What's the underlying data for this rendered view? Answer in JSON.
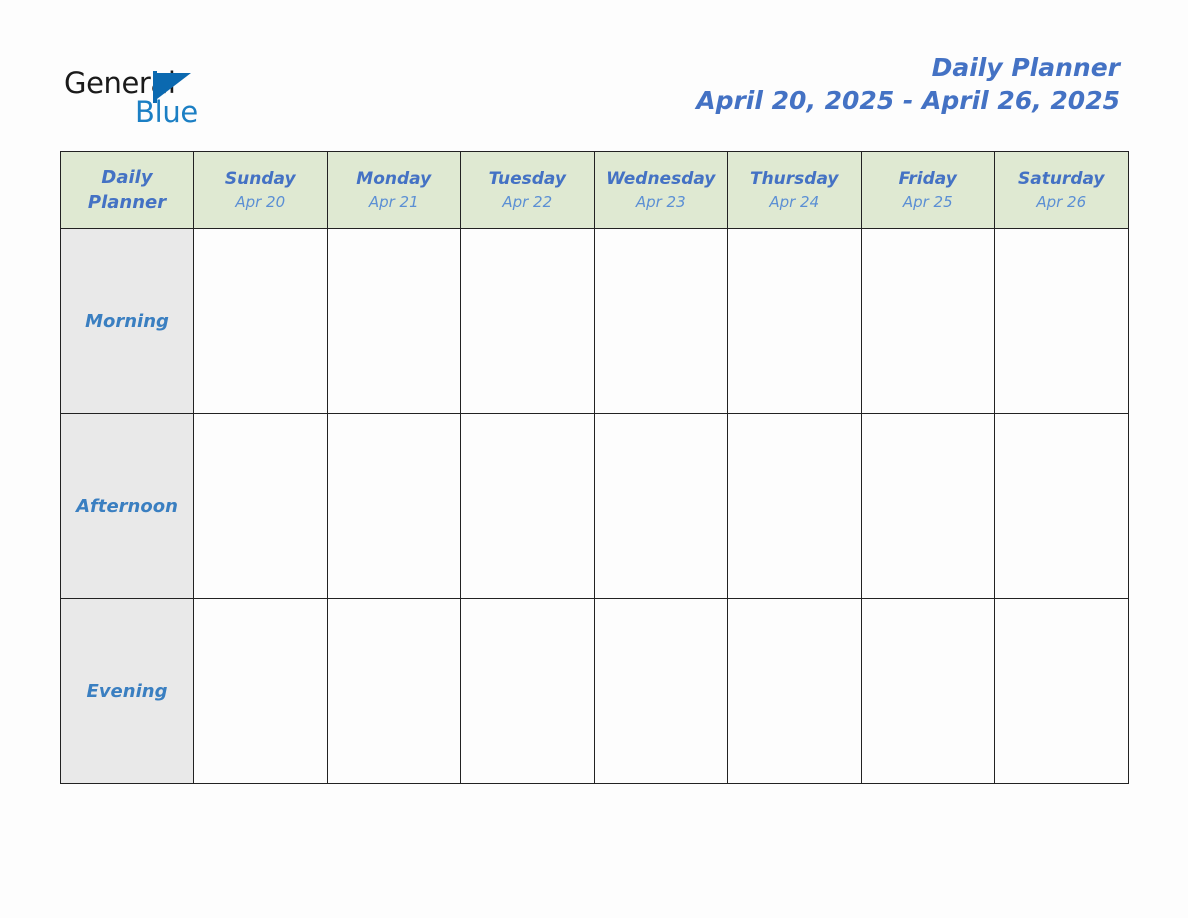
{
  "brand": {
    "name_part1": "General",
    "name_part2": "Blue",
    "flag_icon": "triangle-flag-icon",
    "accent_color": "#0b69b0",
    "blue_text_color": "#1b7fc4"
  },
  "header": {
    "title": "Daily Planner",
    "date_range": "April 20, 2025 - April 26, 2025",
    "title_color": "#4472c4"
  },
  "table": {
    "corner": {
      "line1": "Daily",
      "line2": "Planner"
    },
    "header_bg": "#dfe9d2",
    "rowlabel_bg": "#e9e9e9",
    "border_color": "#222222",
    "columns": [
      {
        "day": "Sunday",
        "date": "Apr 20"
      },
      {
        "day": "Monday",
        "date": "Apr 21"
      },
      {
        "day": "Tuesday",
        "date": "Apr 22"
      },
      {
        "day": "Wednesday",
        "date": "Apr 23"
      },
      {
        "day": "Thursday",
        "date": "Apr 24"
      },
      {
        "day": "Friday",
        "date": "Apr 25"
      },
      {
        "day": "Saturday",
        "date": "Apr 26"
      }
    ],
    "rows": [
      {
        "label": "Morning",
        "cells": [
          "",
          "",
          "",
          "",
          "",
          "",
          ""
        ]
      },
      {
        "label": "Afternoon",
        "cells": [
          "",
          "",
          "",
          "",
          "",
          "",
          ""
        ]
      },
      {
        "label": "Evening",
        "cells": [
          "",
          "",
          "",
          "",
          "",
          "",
          ""
        ]
      }
    ]
  }
}
